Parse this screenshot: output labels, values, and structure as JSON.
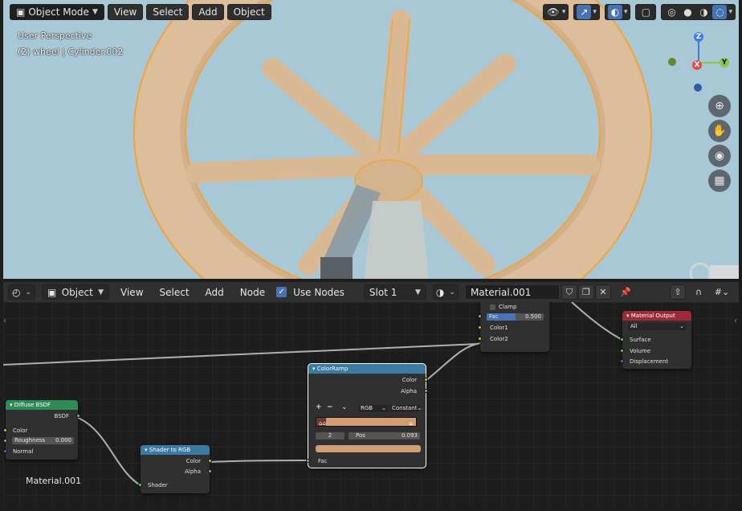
{
  "viewport": {
    "mode_label": "Object Mode",
    "menus": [
      "View",
      "Select",
      "Add",
      "Object"
    ],
    "overlay_line1": "User Perspective",
    "overlay_line2": "(2) wheel | Cylinder.002",
    "gizmo": {
      "z": "Z",
      "y": "Y",
      "x": "X"
    },
    "colors": {
      "background": "#a9c8d6",
      "wood": "#dcbf9a",
      "selection_outline": "#f0a33a",
      "axis_x": "#e5494d",
      "axis_y": "#8bc63e",
      "axis_z": "#3d7fe0"
    }
  },
  "node_header": {
    "editor_type_icon": "node-editor-icon",
    "object_dropdown": "Object",
    "menus": [
      "View",
      "Select",
      "Add",
      "Node"
    ],
    "use_nodes_label": "Use Nodes",
    "use_nodes_checked": true,
    "slot_label": "Slot 1",
    "material_name": "Material.001"
  },
  "nodes": {
    "diffuse": {
      "title": "Diffuse BSDF",
      "out": "BSDF",
      "color": "Color",
      "roughness_label": "Roughness",
      "roughness_value": "0.000",
      "normal": "Normal"
    },
    "shader_to_rgb": {
      "title": "Shader to RGB",
      "color": "Color",
      "alpha": "Alpha",
      "shader": "Shader"
    },
    "color_ramp": {
      "title": "ColorRamp",
      "color": "Color",
      "alpha": "Alpha",
      "add": "+",
      "remove": "−",
      "more": "⌄",
      "mode": "RGB",
      "interpolation": "Constant",
      "index": "2",
      "pos_label": "Pos",
      "pos_value": "0.093",
      "fac": "Fac",
      "ramp_color": "#d19e74"
    },
    "mix": {
      "clamp": "Clamp",
      "fac_label": "Fac",
      "fac_value": "0.500",
      "fac_fill": 0.5,
      "color1": "Color1",
      "color2": "Color2"
    },
    "output": {
      "title": "Material Output",
      "target": "All",
      "surface": "Surface",
      "volume": "Volume",
      "displacement": "Displacement"
    }
  },
  "bottom_label": "Material.001"
}
